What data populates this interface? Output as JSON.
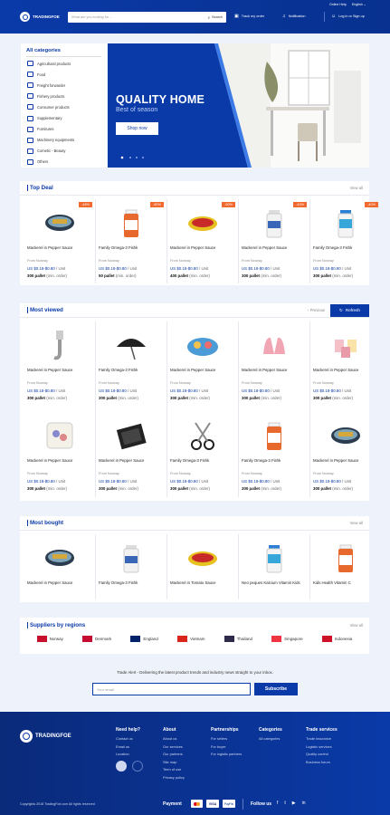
{
  "header": {
    "logo": "TRADINGFOE",
    "topright_help": "Online Help",
    "topright_lang": "English",
    "search_placeholder": "What are you looking for ...",
    "search_button": "Search",
    "track": "Track my order",
    "notification": "Notification",
    "login": "Log in or Sign up"
  },
  "categories": {
    "title": "All categories",
    "items": [
      "Agricultural products",
      "Food",
      "Freight forwarder",
      "Fishery products",
      "Consumer products",
      "Supplementary",
      "Furnitures",
      "Machinery equipments",
      "Cometic - Beauty",
      "Others"
    ]
  },
  "banner": {
    "title": "QUALITY HOME",
    "subtitle": "Best of season",
    "button": "Shop now"
  },
  "top_deal": {
    "title": "Top Deal",
    "view_all": "View all",
    "items": [
      {
        "name": "Mackerel in Pepper Sauce",
        "from": "From Norway",
        "price": "US $0.18-$0.80",
        "unit": "/ Unit",
        "moq": "300 pallet",
        "moq_note": "(min. order)",
        "badge": "-48%",
        "img": "tin"
      },
      {
        "name": "Family Omega-3 Fishk",
        "from": "From Norway",
        "price": "US $0.18-$0.80",
        "unit": "/ Unit",
        "moq": "50 pallet",
        "moq_note": "(min. order)",
        "badge": "-80%",
        "img": "bottle"
      },
      {
        "name": "Mackerel in Pepper Sauce",
        "from": "From Norway",
        "price": "US $0.18-$0.80",
        "unit": "/ Unit",
        "moq": "400 pallet",
        "moq_note": "(min. order)",
        "badge": "-50%",
        "img": "tin_yellow"
      },
      {
        "name": "Mackerel in Pepper Sauce",
        "from": "From Norway",
        "price": "US $0.18-$0.80",
        "unit": "/ Unit",
        "moq": "300 pallet",
        "moq_note": "(min. order)",
        "badge": "-40%",
        "img": "bottle_white"
      },
      {
        "name": "Family Omega-3 Fishk",
        "from": "From Norway",
        "price": "US $0.18-$0.80",
        "unit": "/ Unit",
        "moq": "300 pallet",
        "moq_note": "(min. order)",
        "badge": "-40%",
        "img": "bottle_blue"
      }
    ]
  },
  "most_viewed": {
    "title": "Most viewed",
    "previous": "Previous",
    "refresh": "Refresh",
    "items": [
      {
        "name": "Mackerel in Pepper Sauce",
        "from": "From Norway",
        "price": "US $0.18-$0.80",
        "unit": "/ Unit",
        "moq": "300 pallet",
        "moq_note": "(min. order)",
        "img": "hook"
      },
      {
        "name": "Family Omega-3 Fishk",
        "from": "From Norway",
        "price": "US $0.18-$0.80",
        "unit": "/ Unit",
        "moq": "300 pallet",
        "moq_note": "(min. order)",
        "img": "umbrella"
      },
      {
        "name": "Mackerel in Pepper Sauce",
        "from": "From Norway",
        "price": "US $0.18-$0.80",
        "unit": "/ Unit",
        "moq": "300 pallet",
        "moq_note": "(min. order)",
        "img": "plate"
      },
      {
        "name": "Mackerel in Pepper Sauce",
        "from": "From Norway",
        "price": "US $0.18-$0.80",
        "unit": "/ Unit",
        "moq": "300 pallet",
        "moq_note": "(min. order)",
        "img": "gloves"
      },
      {
        "name": "Mackerel in Pepper Sauce",
        "from": "From Norway",
        "price": "US $0.18-$0.80",
        "unit": "/ Unit",
        "moq": "300 pallet",
        "moq_note": "(min. order)",
        "img": "cups"
      },
      {
        "name": "Mackerel in Pepper Sauce",
        "from": "From Norway",
        "price": "US $0.18-$0.80",
        "unit": "/ Unit",
        "moq": "300 pallet",
        "moq_note": "(min. order)",
        "img": "pillow"
      },
      {
        "name": "Mackerel in Pepper Sauce",
        "from": "From Norway",
        "price": "US $0.18-$0.80",
        "unit": "/ Unit",
        "moq": "300 pallet",
        "moq_note": "(min. order)",
        "img": "tray"
      },
      {
        "name": "Family Omega-3 Fishk",
        "from": "From Norway",
        "price": "US $0.18-$0.80",
        "unit": "/ Unit",
        "moq": "300 pallet",
        "moq_note": "(min. order)",
        "img": "scissors"
      },
      {
        "name": "Family Omega-3 Fishk",
        "from": "From Norway",
        "price": "US $0.18-$0.80",
        "unit": "/ Unit",
        "moq": "300 pallet",
        "moq_note": "(min. order)",
        "img": "bottle"
      },
      {
        "name": "Mackerel in Pepper Sauce",
        "from": "From Norway",
        "price": "US $0.18-$0.80",
        "unit": "/ Unit",
        "moq": "300 pallet",
        "moq_note": "(min. order)",
        "img": "tin"
      }
    ]
  },
  "most_bought": {
    "title": "Most bought",
    "view_all": "View all",
    "items": [
      {
        "name": "Mackerel in Pepper Sauce",
        "img": "tin"
      },
      {
        "name": "Family Omega-3 Fishk",
        "img": "bottle_white"
      },
      {
        "name": "Mackerel in Tomato Sauce",
        "img": "tin_yellow"
      },
      {
        "name": "Neo peques Kalcium Vitamin Kids",
        "img": "bottle_blue"
      },
      {
        "name": "Kids Health Vitamin C",
        "img": "bottle"
      }
    ]
  },
  "suppliers": {
    "title": "Suppliers by regions",
    "view_all": "View all",
    "regions": [
      {
        "name": "Norway",
        "flag": "#c8102e"
      },
      {
        "name": "Denmark",
        "flag": "#c60c30"
      },
      {
        "name": "England",
        "flag": "#012169"
      },
      {
        "name": "Vietnam",
        "flag": "#da251d"
      },
      {
        "name": "Thailand",
        "flag": "#2d2a4a"
      },
      {
        "name": "Singapore",
        "flag": "#ef3340"
      },
      {
        "name": "Indonesia",
        "flag": "#ce1126"
      }
    ]
  },
  "newsletter": {
    "text": "Trade Alert - Delivering the latest product trends and industry news straight to your inbox.",
    "placeholder": "Your email",
    "button": "Subscribe"
  },
  "footer": {
    "logo": "TRADINGFOE",
    "copyright": "Copyrights 2018 TradingFoe.com All rights reserved",
    "cols": [
      {
        "h": "Need help?",
        "items": [
          "Contact us",
          "Email us",
          "Location"
        ]
      },
      {
        "h": "About",
        "items": [
          "About us",
          "Our services",
          "Our partners",
          "Site map",
          "Term of use",
          "Privacy policy"
        ]
      },
      {
        "h": "Partnerships",
        "items": [
          "For sellers",
          "For buyer",
          "For logistic partners"
        ]
      },
      {
        "h": "Categories",
        "items": [
          "All categories"
        ]
      },
      {
        "h": "Trade services",
        "items": [
          "Trade insurance",
          "Logistic services",
          "Quality control",
          "Business forum"
        ]
      }
    ],
    "payment": "Payment",
    "payments": [
      "MC",
      "VISA",
      "PayPal"
    ],
    "follow": "Follow us"
  },
  "colors": {
    "primary": "#0a3aa8",
    "badge": "#f1692c"
  }
}
